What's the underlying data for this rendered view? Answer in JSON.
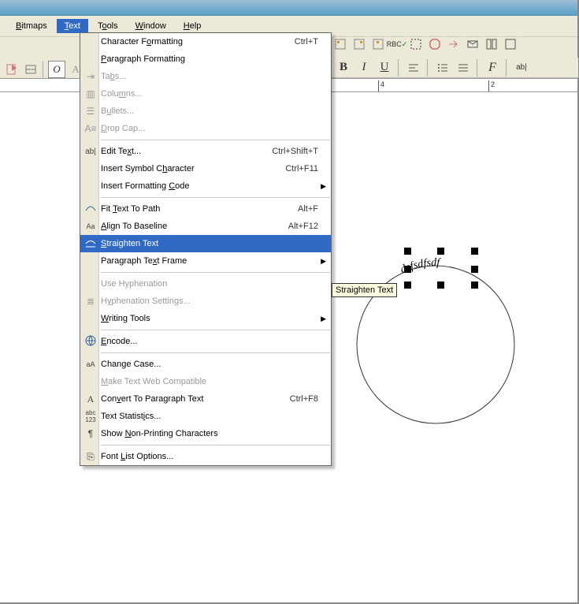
{
  "menubar": {
    "bitmaps": "Bitmaps",
    "text": "Text",
    "tools": "Tools",
    "window": "Window",
    "help": "Help"
  },
  "ruler": {
    "mark4": "4",
    "mark2": "2"
  },
  "menu": {
    "char_fmt": "Character Formatting",
    "char_fmt_sc": "Ctrl+T",
    "para_fmt": "Paragraph Formatting",
    "tabs": "Tabs...",
    "columns": "Columns...",
    "bullets": "Bullets...",
    "dropcap": "Drop Cap...",
    "edit_text": "Edit Text...",
    "edit_text_sc": "Ctrl+Shift+T",
    "insert_symbol": "Insert Symbol Character",
    "insert_symbol_sc": "Ctrl+F11",
    "insert_fmt_code": "Insert Formatting Code",
    "fit_path": "Fit Text To Path",
    "fit_path_sc": "Alt+F",
    "align_baseline": "Align To Baseline",
    "align_baseline_sc": "Alt+F12",
    "straighten": "Straighten Text",
    "para_frame": "Paragraph Text Frame",
    "use_hyphen": "Use Hyphenation",
    "hyphen_settings": "Hyphenation Settings...",
    "writing_tools": "Writing Tools",
    "encode": "Encode...",
    "change_case": "Change Case...",
    "web_compat": "Make Text Web Compatible",
    "convert_para": "Convert To Paragraph Text",
    "convert_para_sc": "Ctrl+F8",
    "text_stats": "Text Statistics...",
    "show_nonprint": "Show Non-Printing Characters",
    "font_list": "Font List Options..."
  },
  "tooltip": "Straighten Text",
  "canvas": {
    "path_text": "dsfsdfsdf"
  },
  "toolbar2": {
    "bold": "B",
    "italic": "I",
    "underline": "U",
    "fscript": "F",
    "ab": "ab|"
  },
  "toolbar_left": {
    "italic_o": "O",
    "letter_a": "A"
  }
}
